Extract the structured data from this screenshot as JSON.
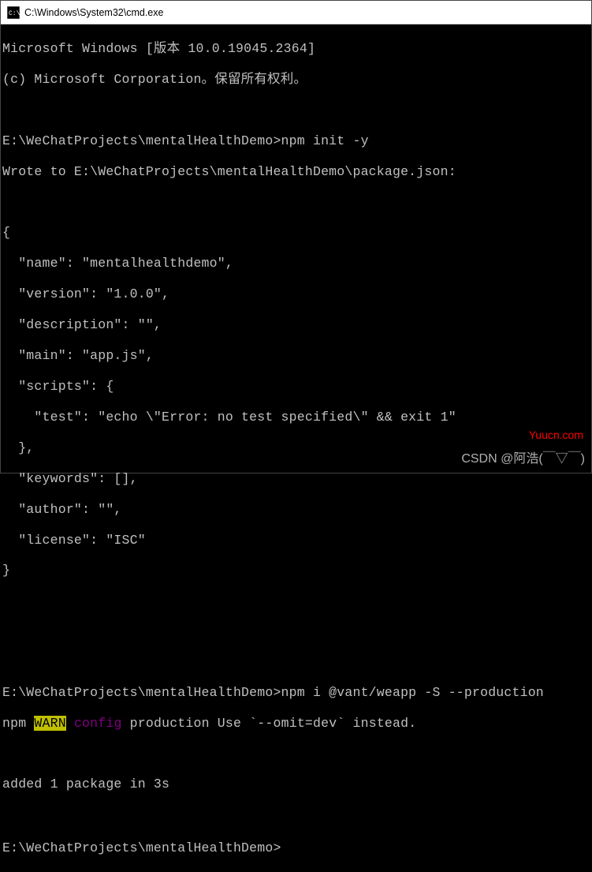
{
  "titlebar": {
    "title": "C:\\Windows\\System32\\cmd.exe"
  },
  "lines": {
    "l0": "Microsoft Windows [版本 10.0.19045.2364]",
    "l1": "(c) Microsoft Corporation。保留所有权利。",
    "l2": "",
    "l3": "E:\\WeChatProjects\\mentalHealthDemo>npm init -y",
    "l4": "Wrote to E:\\WeChatProjects\\mentalHealthDemo\\package.json:",
    "l5": "",
    "l6": "{",
    "l7": "  \"name\": \"mentalhealthdemo\",",
    "l8": "  \"version\": \"1.0.0\",",
    "l9": "  \"description\": \"\",",
    "l10": "  \"main\": \"app.js\",",
    "l11": "  \"scripts\": {",
    "l12": "    \"test\": \"echo \\\"Error: no test specified\\\" && exit 1\"",
    "l13": "  },",
    "l14": "  \"keywords\": [],",
    "l15": "  \"author\": \"\",",
    "l16": "  \"license\": \"ISC\"",
    "l17": "}",
    "l18": "",
    "l19": "",
    "l20": "",
    "l21": "E:\\WeChatProjects\\mentalHealthDemo>npm i @vant/weapp -S --production",
    "l22a": "npm ",
    "l22b": "WARN",
    "l22c": " ",
    "l22d": "config",
    "l22e": " production Use `--omit=dev` instead.",
    "l23": "",
    "l24": "added 1 package in 3s",
    "l25": "",
    "l26": "E:\\WeChatProjects\\mentalHealthDemo>"
  },
  "watermarks": {
    "w1": "Yuucn.com",
    "w2": "CSDN @阿浩(￣▽￣)"
  }
}
